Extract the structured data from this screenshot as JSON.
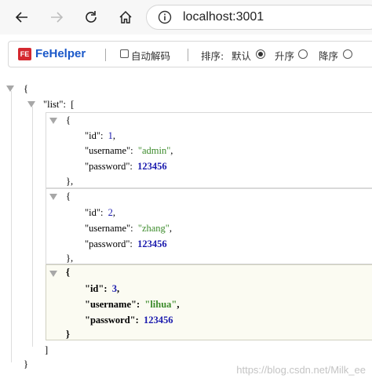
{
  "browser": {
    "url": "localhost:3001"
  },
  "fehelper": {
    "title": "FeHelper",
    "logo_text": "FE",
    "auto_decode_label": "自动解码",
    "auto_decode_checked": false,
    "sort_label": "排序:",
    "sort_options": [
      "默认",
      "升序",
      "降序"
    ],
    "sort_selected": "默认"
  },
  "json": {
    "open_brace": "{",
    "list_key": "\"list\"",
    "list_open": "[",
    "items": [
      {
        "id_key": "\"id\"",
        "id": "1",
        "username_key": "\"username\"",
        "username": "\"admin\"",
        "password_key": "\"password\"",
        "password": "123456"
      },
      {
        "id_key": "\"id\"",
        "id": "2",
        "username_key": "\"username\"",
        "username": "\"zhang\"",
        "password_key": "\"password\"",
        "password": "123456"
      },
      {
        "id_key": "\"id\"",
        "id": "3",
        "username_key": "\"username\"",
        "username": "\"lihua\"",
        "password_key": "\"password\"",
        "password": "123456"
      }
    ],
    "close_item_comma": "},",
    "close_item": "}",
    "list_close": "]",
    "close_brace": "}"
  },
  "watermark": "https://blog.csdn.net/Milk_ee"
}
